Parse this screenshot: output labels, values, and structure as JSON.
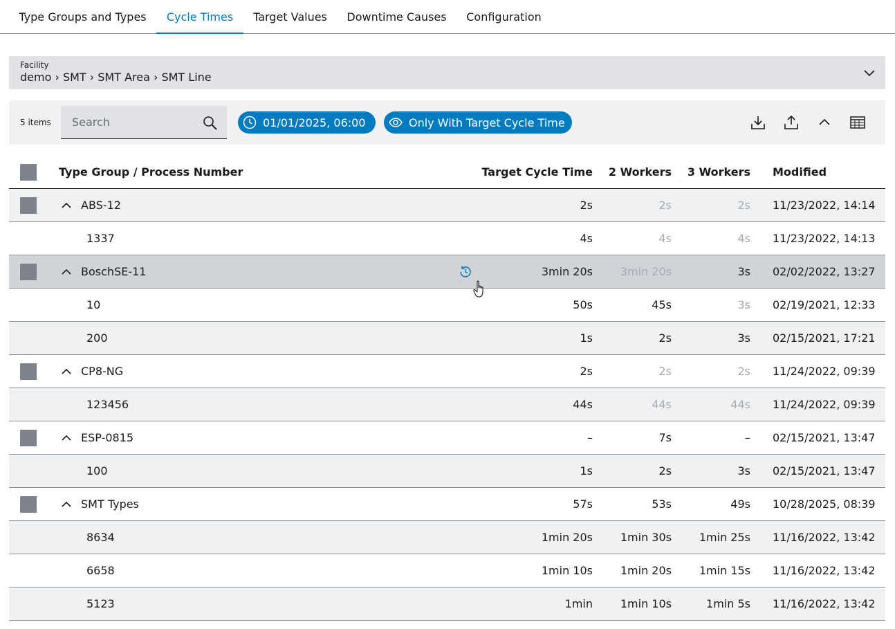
{
  "tabs": [
    {
      "label": "Type Groups and Types"
    },
    {
      "label": "Cycle Times"
    },
    {
      "label": "Target Values"
    },
    {
      "label": "Downtime Causes"
    },
    {
      "label": "Configuration"
    }
  ],
  "facility": {
    "label": "Facility",
    "path": "demo › SMT › SMT Area › SMT Line"
  },
  "toolbar": {
    "count": "5 items",
    "search_placeholder": "Search",
    "date_chip": "01/01/2025, 06:00",
    "filter_chip": "Only With Target Cycle Time"
  },
  "colors": {
    "accent": "#007bc0",
    "header_bar": "#e0e2e5",
    "toolbar_bg": "#eff1f2",
    "row_alt": "#eff1f2",
    "row_hover": "#d0d4d8",
    "checkbox": "#7d8389",
    "muted_text": "#a4abb3"
  },
  "icons": {
    "search": "search-icon",
    "date": "clock-icon",
    "filter": "eye-icon",
    "download": "download-icon",
    "upload": "upload-icon",
    "collapse": "chevron-up-icon",
    "columns": "table-settings-icon",
    "history": "history-icon",
    "facility_toggle": "chevron-down-icon"
  },
  "table": {
    "headers": {
      "name": "Type Group / Process Number",
      "target": "Target Cycle Time",
      "two": "2 Workers",
      "three": "3 Workers",
      "modified": "Modified"
    },
    "rows": [
      {
        "name": "ABS-12",
        "group": true,
        "target": "2s",
        "two": "2s",
        "three": "2s",
        "modified": "11/23/2022, 14:14",
        "two_muted": true,
        "three_muted": true
      },
      {
        "name": "1337",
        "group": false,
        "target": "4s",
        "two": "4s",
        "three": "4s",
        "modified": "11/23/2022, 14:13",
        "two_muted": true,
        "three_muted": true
      },
      {
        "name": "BoschSE-11",
        "group": true,
        "target": "3min 20s",
        "two": "3min 20s",
        "three": "3s",
        "modified": "02/02/2022, 13:27",
        "two_muted": true,
        "three_muted": false,
        "hover": true
      },
      {
        "name": "10",
        "group": false,
        "target": "50s",
        "two": "45s",
        "three": "3s",
        "modified": "02/19/2021, 12:33",
        "two_muted": false,
        "three_muted": true
      },
      {
        "name": "200",
        "group": false,
        "target": "1s",
        "two": "2s",
        "three": "3s",
        "modified": "02/15/2021, 17:21",
        "two_muted": false,
        "three_muted": false
      },
      {
        "name": "CP8-NG",
        "group": true,
        "target": "2s",
        "two": "2s",
        "three": "2s",
        "modified": "11/24/2022, 09:39",
        "two_muted": true,
        "three_muted": true
      },
      {
        "name": "123456",
        "group": false,
        "target": "44s",
        "two": "44s",
        "three": "44s",
        "modified": "11/24/2022, 09:39",
        "two_muted": true,
        "three_muted": true
      },
      {
        "name": "ESP-0815",
        "group": true,
        "target": "–",
        "two": "7s",
        "three": "–",
        "modified": "02/15/2021, 13:47",
        "two_muted": false,
        "three_muted": false
      },
      {
        "name": "100",
        "group": false,
        "target": "1s",
        "two": "2s",
        "three": "3s",
        "modified": "02/15/2021, 13:47",
        "two_muted": false,
        "three_muted": false
      },
      {
        "name": "SMT Types",
        "group": true,
        "target": "57s",
        "two": "53s",
        "three": "49s",
        "modified": "10/28/2025, 08:39",
        "two_muted": false,
        "three_muted": false
      },
      {
        "name": "8634",
        "group": false,
        "target": "1min 20s",
        "two": "1min 30s",
        "three": "1min 25s",
        "modified": "11/16/2022, 13:42",
        "two_muted": false,
        "three_muted": false
      },
      {
        "name": "6658",
        "group": false,
        "target": "1min 10s",
        "two": "1min 20s",
        "three": "1min 15s",
        "modified": "11/16/2022, 13:42",
        "two_muted": false,
        "three_muted": false
      },
      {
        "name": "5123",
        "group": false,
        "target": "1min",
        "two": "1min 10s",
        "three": "1min 5s",
        "modified": "11/16/2022, 13:42",
        "two_muted": false,
        "three_muted": false
      }
    ]
  }
}
